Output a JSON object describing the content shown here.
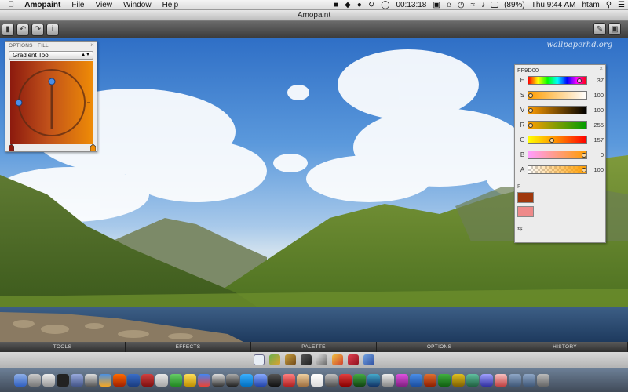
{
  "menubar": {
    "apple": "",
    "app_name": "Amopaint",
    "items": [
      "File",
      "View",
      "Window",
      "Help"
    ],
    "timer": "00:13:18",
    "battery": "(89%)",
    "clock": "Thu 9:44 AM",
    "user": "htam"
  },
  "window": {
    "title": "Amopaint"
  },
  "canvas": {
    "watermark": "wallpaperhd.org"
  },
  "options_panel": {
    "header": "OPTIONS · FILL",
    "tool": "Gradient Tool",
    "gradient_start": "#8c1a0e",
    "gradient_end": "#ef8c06"
  },
  "color_panel": {
    "hex": "FF9D00",
    "channels": [
      {
        "label": "H",
        "value": "37",
        "fraction": 0.91
      },
      {
        "label": "S",
        "value": "100",
        "fraction": 0.0
      },
      {
        "label": "V",
        "value": "100",
        "fraction": 0.0
      },
      {
        "label": "R",
        "value": "255",
        "fraction": 0.0
      },
      {
        "label": "G",
        "value": "157",
        "fraction": 0.4
      },
      {
        "label": "B",
        "value": "0",
        "fraction": 1.0
      },
      {
        "label": "A",
        "value": "100",
        "fraction": 1.0
      }
    ],
    "fb_label": "F",
    "foreground": "#a0380c",
    "background": "#ee8a8a"
  },
  "bottom_tabs": [
    "TOOLS",
    "EFFECTS",
    "PALETTE",
    "OPTIONS",
    "HISTORY"
  ],
  "colors": {
    "toolbar": "#4a4a4a",
    "accent_orange": "#ff9d00"
  }
}
